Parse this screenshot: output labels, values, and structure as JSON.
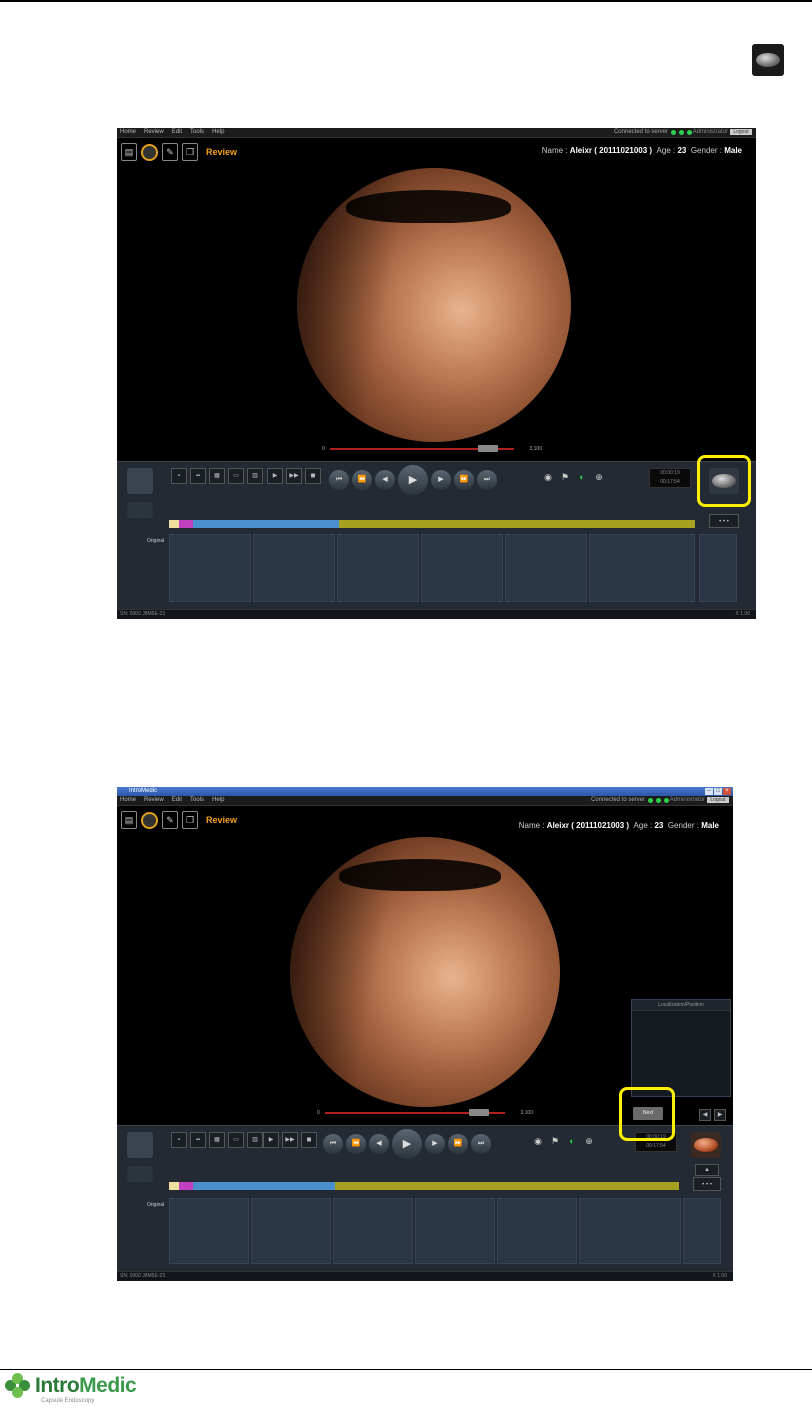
{
  "app": {
    "window_title": "IntroMedic",
    "menu": [
      "Home",
      "Review",
      "Edit",
      "Tools",
      "Help"
    ],
    "connection_status": "Connected to server",
    "user": "Administrator",
    "logout_label": "Logout",
    "view_label": "Review",
    "patient": {
      "name_label": "Name :",
      "name": "Aleixr ( 20111021003 )",
      "age_label": "Age :",
      "age": "23",
      "gender_label": "Gender :",
      "gender": "Male"
    },
    "scrub_min": "0",
    "scrub_max": "3,100",
    "timecode_main": "00:00:19",
    "timecode_sub": "00:17:54",
    "thumb_label": "Original",
    "side_panel_title": "Localization/Position",
    "next_label": "Next",
    "status_left": "SN: 0000 J8M5E-23",
    "status_right": "X 1.00"
  },
  "footer": {
    "brand_intro": "Intro",
    "brand_medic": "Medic",
    "tagline": "Capsule Endoscopy"
  },
  "colors": {
    "highlight": "#ffef00",
    "timeline_blue": "#4a8fd0",
    "timeline_olive": "#a8a020"
  }
}
